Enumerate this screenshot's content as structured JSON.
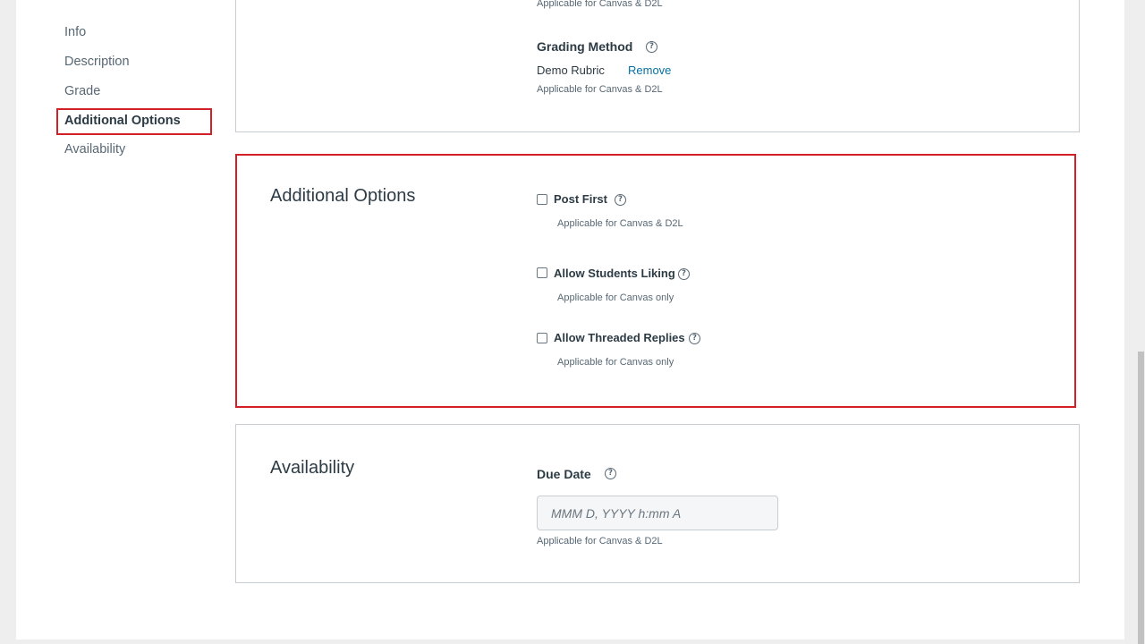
{
  "sidebar": {
    "items": [
      {
        "label": "Info"
      },
      {
        "label": "Description"
      },
      {
        "label": "Grade"
      },
      {
        "label": "Additional Options"
      },
      {
        "label": "Availability"
      }
    ]
  },
  "grade_section": {
    "top_note": "Applicable for Canvas & D2L",
    "grading_method_label": "Grading Method",
    "rubric_name": "Demo Rubric",
    "remove_label": "Remove",
    "note": "Applicable for Canvas & D2L"
  },
  "additional_options": {
    "title": "Additional Options",
    "options": [
      {
        "label": "Post First",
        "note": "Applicable for Canvas & D2L",
        "checked": false
      },
      {
        "label": "Allow Students Liking",
        "note": "Applicable for Canvas only",
        "checked": false
      },
      {
        "label": "Allow Threaded Replies",
        "note": "Applicable for Canvas only",
        "checked": false
      }
    ]
  },
  "availability": {
    "title": "Availability",
    "due_date_label": "Due Date",
    "due_date_placeholder": "MMM D, YYYY h:mm A",
    "due_date_value": "",
    "note": "Applicable for Canvas & D2L"
  },
  "colors": {
    "highlight": "#d31f26",
    "link": "#0770a3"
  },
  "icons": {
    "help": "?"
  }
}
